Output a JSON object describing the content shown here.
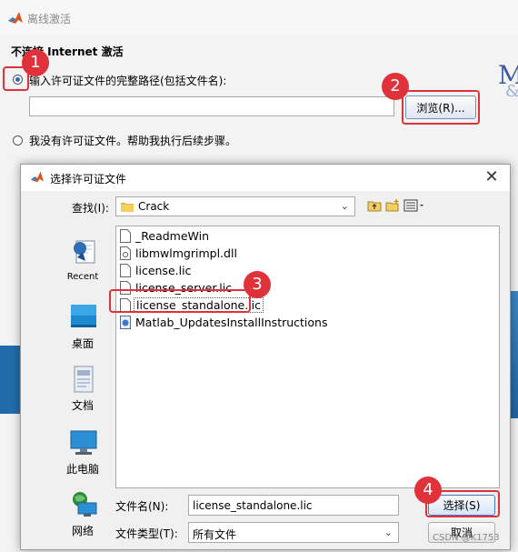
{
  "main_window": {
    "title": "离线激活",
    "heading": "不连接 Internet 激活",
    "option1_label": "输入许可证文件的完整路径(包括文件名):",
    "path_value": "",
    "browse_label": "浏览(R)...",
    "option2_label": "我没有许可证文件。帮助我执行后续步骤。",
    "logo_text": "M",
    "logo_text2": "&"
  },
  "dialog": {
    "title": "选择许可证文件",
    "close_glyph": "✕",
    "look_in_label": "查找(I):",
    "look_in_value": "Crack",
    "places": [
      {
        "label": "Recent",
        "icon": "recent-icon"
      },
      {
        "label": "桌面",
        "icon": "desktop-icon"
      },
      {
        "label": "文档",
        "icon": "documents-icon"
      },
      {
        "label": "此电脑",
        "icon": "computer-icon"
      },
      {
        "label": "网络",
        "icon": "network-icon"
      }
    ],
    "files": [
      {
        "name": "_ReadmeWin",
        "icon": "file-icon"
      },
      {
        "name": "libmwlmgrimpl.dll",
        "icon": "dll-file-icon"
      },
      {
        "name": "license.lic",
        "icon": "file-icon"
      },
      {
        "name": "license_server.lic",
        "icon": "file-icon"
      },
      {
        "name": "license_standalone.lic",
        "icon": "file-icon",
        "selected": true
      },
      {
        "name": "Matlab_UpdatesInstallInstructions",
        "icon": "help-file-icon"
      }
    ],
    "file_name_label": "文件名(N):",
    "file_name_value": "license_standalone.lic",
    "file_type_label": "文件类型(T):",
    "file_type_value": "所有文件",
    "select_label": "选择(S)",
    "cancel_label": "取消"
  },
  "annotations": {
    "steps": [
      "1",
      "2",
      "3",
      "4"
    ],
    "color": "#e0323a"
  },
  "watermark": "CSDN @K1753",
  "colors": {
    "accent": "#2a66c9",
    "highlight": "#e0323a",
    "folder": "#e8b93c"
  }
}
